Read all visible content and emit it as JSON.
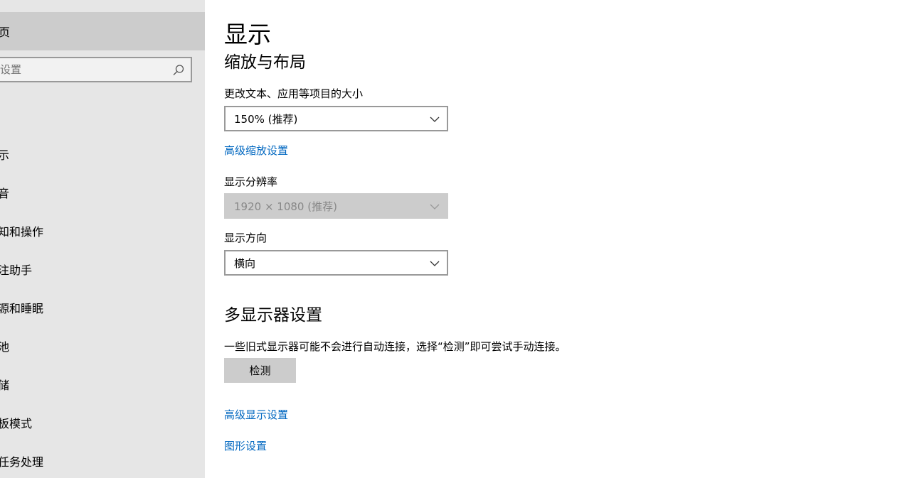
{
  "sidebar": {
    "home_label": "页",
    "search_placeholder": "设置",
    "items": [
      {
        "label": "示"
      },
      {
        "label": "音"
      },
      {
        "label": "知和操作"
      },
      {
        "label": "注助手"
      },
      {
        "label": "源和睡眠"
      },
      {
        "label": "池"
      },
      {
        "label": "储"
      },
      {
        "label": "板模式"
      },
      {
        "label": "任务处理"
      }
    ]
  },
  "main": {
    "title": "显示",
    "scale_section": {
      "title": "缩放与布局",
      "size_label": "更改文本、应用等项目的大小",
      "size_value": "150% (推荐)",
      "advanced_scaling_link": "高级缩放设置",
      "resolution_label": "显示分辨率",
      "resolution_value": "1920 × 1080 (推荐)",
      "orientation_label": "显示方向",
      "orientation_value": "横向"
    },
    "multi_section": {
      "title": "多显示器设置",
      "description": "一些旧式显示器可能不会进行自动连接，选择“检测”即可尝试手动连接。",
      "detect_button": "检测",
      "advanced_display_link": "高级显示设置",
      "graphics_link": "图形设置"
    }
  },
  "colors": {
    "sidebar_bg": "#e6e6e6",
    "selected_bg": "#cccccc",
    "link": "#0067c0"
  }
}
